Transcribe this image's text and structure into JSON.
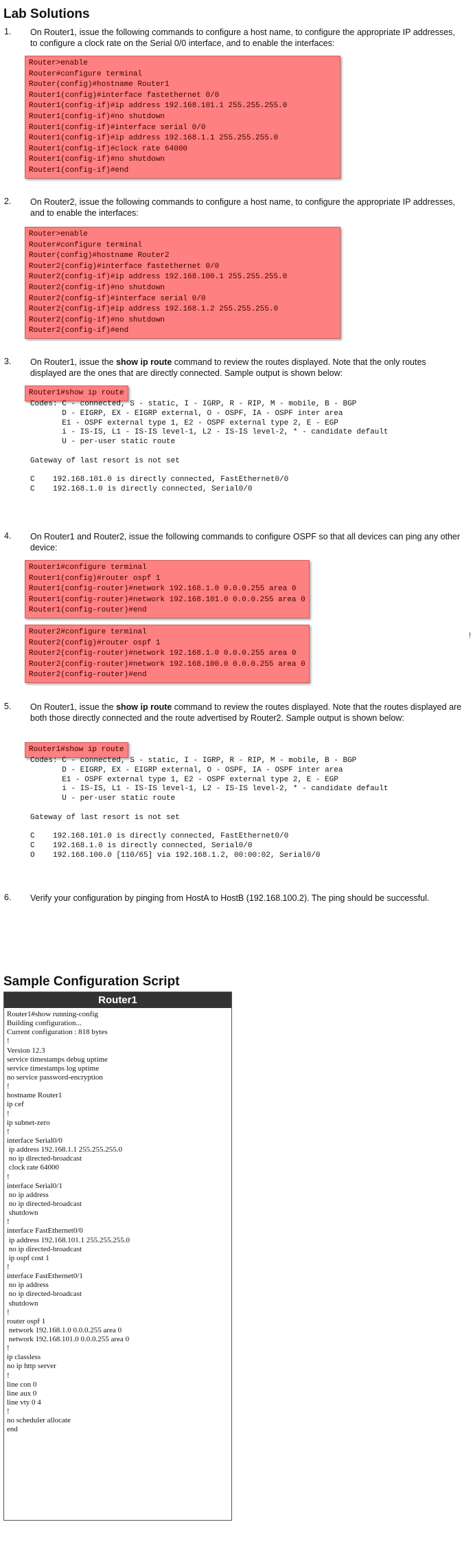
{
  "page_title": "Lab Solutions",
  "steps": [
    {
      "num": "1.",
      "text": "On Router1, issue the following commands to configure a host name, to configure the appropriate IP addresses, to configure a clock rate on the Serial 0/0 interface, and to enable the interfaces:",
      "commands": [
        "Router>enable",
        "Router#configure terminal",
        "Router(config)#hostname Router1",
        "Router1(config)#interface fastethernet 0/0",
        "Router1(config-if)#ip address 192.168.101.1 255.255.255.0",
        "Router1(config-if)#no shutdown",
        "Router1(config-if)#interface serial 0/0",
        "Router1(config-if)#ip address 192.168.1.1 255.255.255.0",
        "Router1(config-if)#clock rate 64000",
        "Router1(config-if)#no shutdown",
        "Router1(config-if)#end"
      ]
    },
    {
      "num": "2.",
      "text": "On Router2, issue the following commands to configure a host name, to configure the appropriate IP addresses, and to enable the interfaces:",
      "commands": [
        "Router>enable",
        "Router#configure terminal",
        "Router(config)#hostname Router2",
        "Router2(config)#interface fastethernet 0/0",
        "Router2(config-if)#ip address 192.168.100.1 255.255.255.0",
        "Router2(config-if)#no shutdown",
        "Router2(config-if)#interface serial 0/0",
        "Router2(config-if)#ip address 192.168.1.2 255.255.255.0",
        "Router2(config-if)#no shutdown",
        "Router2(config-if)#end"
      ]
    },
    {
      "num": "3.",
      "text_before": "On Router1, issue the ",
      "text_bold": "show ip route",
      "text_after": " command to review the routes displayed. Note that the only routes displayed are the ones that are directly connected. Sample output is shown below:",
      "command": "Router1#show ip route",
      "output": [
        "Codes: C - connected, S - static, I - IGRP, R - RIP, M - mobile, B - BGP",
        "       D - EIGRP, EX - EIGRP external, O - OSPF, IA - OSPF inter area",
        "       E1 - OSPF external type 1, E2 - OSPF external type 2, E - EGP",
        "       i - IS-IS, L1 - IS-IS level-1, L2 - IS-IS level-2, * - candidate default",
        "       U - per-user static route",
        "",
        "Gateway of last resort is not set",
        "",
        "C    192.168.101.0 is directly connected, FastEthernet0/0",
        "C    192.168.1.0 is directly connected, Serial0/0"
      ]
    },
    {
      "num": "4.",
      "text": "On Router1 and Router2, issue the following commands to configure OSPF so that all devices can ping any other device:",
      "commands_a": [
        "Router1#configure terminal",
        "Router1(config)#router ospf 1",
        "Router1(config-router)#network 192.168.1.0 0.0.0.255 area 0",
        "Router1(config-router)#network 192.168.101.0 0.0.0.255 area 0",
        "Router1(config-router)#end"
      ],
      "commands_b": [
        "Router2#configure terminal",
        "Router2(config)#router ospf 1",
        "Router2(config-router)#network 192.168.1.0 0.0.0.255 area 0",
        "Router2(config-router)#network 192.168.100.0 0.0.0.255 area 0",
        "Router2(config-router)#end"
      ],
      "side_mark": "!"
    },
    {
      "num": "5.",
      "text_before": "On Router1, issue the ",
      "text_bold": "show ip route",
      "text_after": " command to review the routes displayed. Note that the routes displayed are both those directly connected and the route advertised by Router2. Sample output is shown below:",
      "command": "Router1#show ip route",
      "output": [
        "Codes: C - connected, S - static, I - IGRP, R - RIP, M - mobile, B - BGP",
        "       D - EIGRP, EX - EIGRP external, O - OSPF, IA - OSPF inter area",
        "       E1 - OSPF external type 1, E2 - OSPF external type 2, E - EGP",
        "       i - IS-IS, L1 - IS-IS level-1, L2 - IS-IS level-2, * - candidate default",
        "       U - per-user static route",
        "",
        "Gateway of last resort is not set",
        "",
        "C    192.168.101.0 is directly connected, FastEthernet0/0",
        "C    192.168.1.0 is directly connected, Serial0/0",
        "O    192.168.100.0 [110/65] via 192.168.1.2, 00:00:02, Serial0/0"
      ]
    },
    {
      "num": "6.",
      "text": "Verify your configuration by pinging from HostA to HostB (192.168.100.2). The ping should be successful."
    }
  ],
  "sample": {
    "title": "Sample Configuration Script",
    "panel_title": "Router1",
    "lines": [
      "Router1#show running-config",
      "Building configuration...",
      "Current configuration : 818 bytes",
      "!",
      "Version 12.3",
      "service timestamps debug uptime",
      "service timestamps log uptime",
      "no service password-encryption",
      "!",
      "hostname Router1",
      "ip cef",
      "!",
      "ip subnet-zero",
      "!",
      "interface Serial0/0",
      " ip address 192.168.1.1 255.255.255.0",
      " no ip directed-broadcast",
      " clock rate 64000",
      "!",
      "interface Serial0/1",
      " no ip address",
      " no ip directed-broadcast",
      " shutdown",
      "!",
      "interface FastEthernet0/0",
      " ip address 192.168.101.1 255.255.255.0",
      " no ip directed-broadcast",
      " ip ospf cost 1",
      "!",
      "interface FastEthernet0/1",
      " no ip address",
      " no ip directed-broadcast",
      " shutdown",
      "!",
      "router ospf 1",
      " network 192.168.1.0 0.0.0.255 area 0",
      " network 192.168.101.0 0.0.0.255 area 0",
      "!",
      "ip classless",
      "no ip http server",
      "!",
      "line con 0",
      "line aux 0",
      "line vty 0 4",
      "!",
      "no scheduler allocate",
      "end"
    ]
  }
}
